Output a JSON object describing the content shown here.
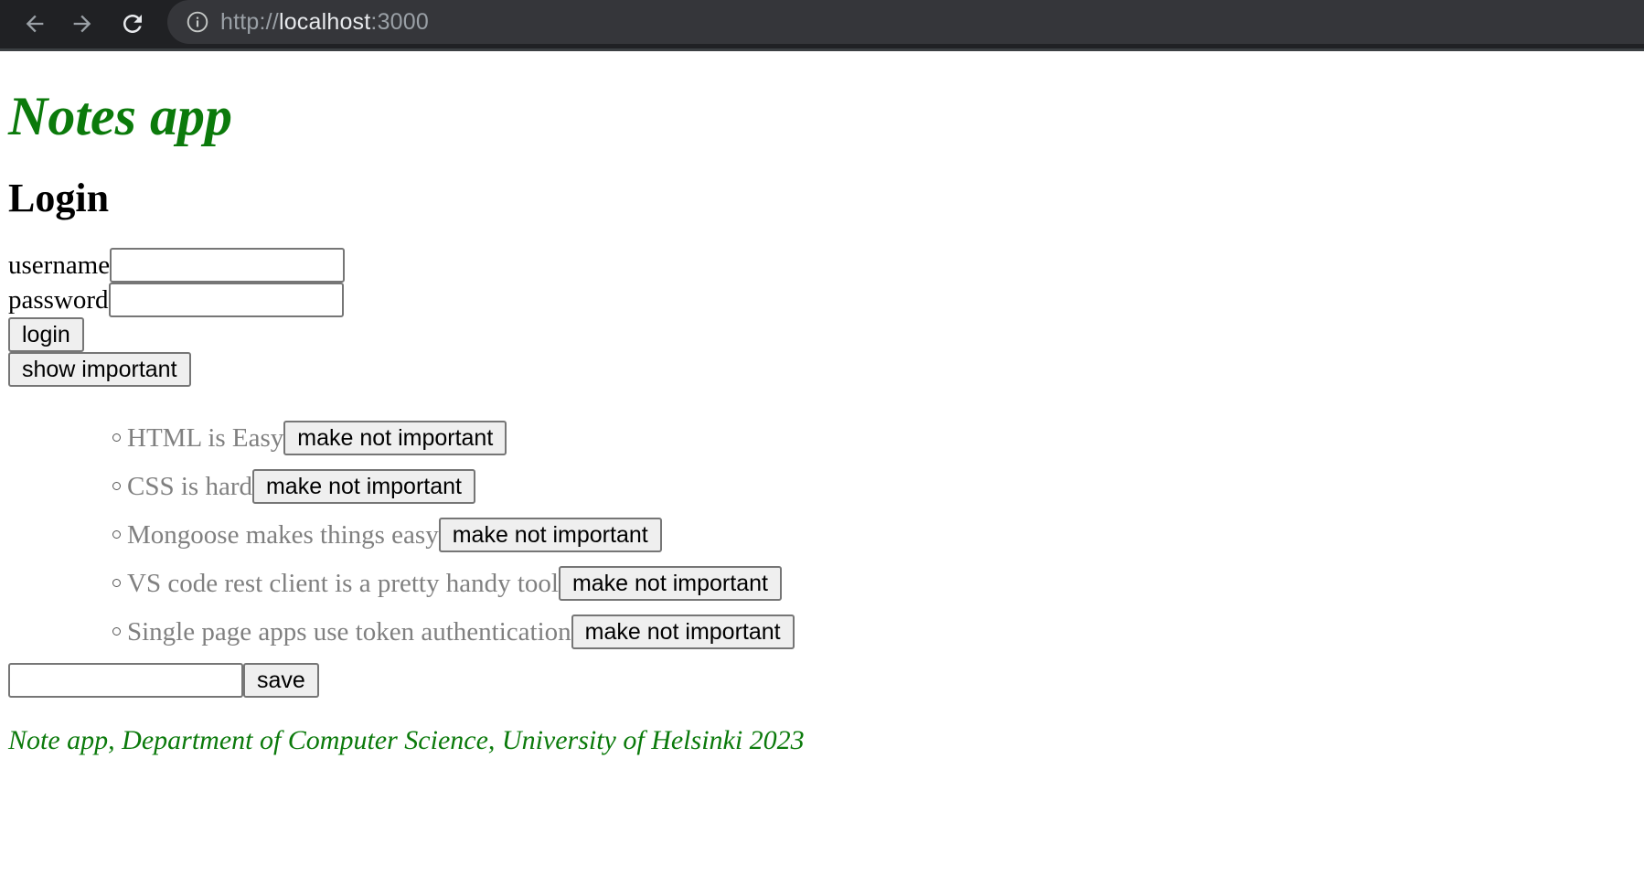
{
  "browser": {
    "url_scheme": "http://",
    "url_host": "localhost",
    "url_port": ":3000"
  },
  "header": {
    "title": "Notes app"
  },
  "login": {
    "heading": "Login",
    "username_label": "username",
    "username_value": "",
    "password_label": "password",
    "password_value": "",
    "login_label": "login"
  },
  "filter": {
    "show_label": "show important"
  },
  "notes": [
    {
      "content": "HTML is Easy",
      "toggle_label": "make not important"
    },
    {
      "content": "CSS is hard",
      "toggle_label": "make not important"
    },
    {
      "content": "Mongoose makes things easy",
      "toggle_label": "make not important"
    },
    {
      "content": "VS code rest client is a pretty handy tool",
      "toggle_label": "make not important"
    },
    {
      "content": "Single page apps use token authentication",
      "toggle_label": "make not important"
    }
  ],
  "new_note": {
    "value": "",
    "save_label": "save"
  },
  "footer": {
    "text": "Note app, Department of Computer Science, University of Helsinki 2023"
  },
  "colors": {
    "title_green": "#0b7a0b",
    "note_gray": "#808080",
    "chrome_dark": "#202124"
  }
}
